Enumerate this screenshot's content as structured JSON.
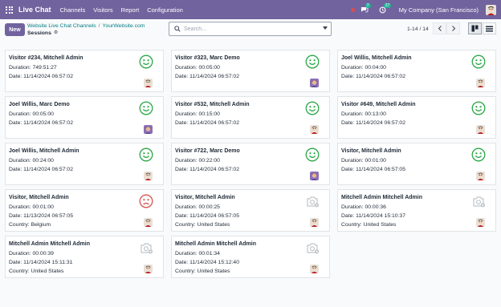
{
  "navbar": {
    "brand": "Live Chat",
    "menu": [
      "Channels",
      "Visitors",
      "Report",
      "Configuration"
    ],
    "chat_badge": "7",
    "activity_badge": "27",
    "company": "My Company (San Francisco)"
  },
  "control": {
    "new_label": "New",
    "breadcrumb_parent": "Website Live Chat Channels",
    "breadcrumb_parent2": "YourWebsite.com",
    "breadcrumb_current": "Sessions",
    "search_placeholder": "Search...",
    "pager": "1-14 / 14"
  },
  "colors": {
    "brand": "#71639e",
    "happy": "#28a745",
    "sad": "#d9534f",
    "none": "#c0c4c9"
  },
  "cards": [
    {
      "title": "Visitor #234, Mitchell Admin",
      "l1": "Duration: 749:51:27",
      "l2": "Date: 11/14/2024 06:57:02",
      "l3": "",
      "rating": "happy",
      "avatar": "admin"
    },
    {
      "title": "Visitor #323, Marc Demo",
      "l1": "Duration: 00:05:00",
      "l2": "Date: 11/14/2024 06:57:02",
      "l3": "",
      "rating": "happy",
      "avatar": "marc"
    },
    {
      "title": "Joel Willis, Mitchell Admin",
      "l1": "Duration: 00:04:00",
      "l2": "Date: 11/14/2024 06:57:02",
      "l3": "",
      "rating": "happy",
      "avatar": "admin"
    },
    {
      "title": "Joel Willis, Marc Demo",
      "l1": "Duration: 00:05:00",
      "l2": "Date: 11/14/2024 06:57:02",
      "l3": "",
      "rating": "happy",
      "avatar": "marc"
    },
    {
      "title": "Visitor #532, Mitchell Admin",
      "l1": "Duration: 00:15:00",
      "l2": "Date: 11/14/2024 06:57:02",
      "l3": "",
      "rating": "happy",
      "avatar": "admin"
    },
    {
      "title": "Visitor #649, Mitchell Admin",
      "l1": "Duration: 00:13:00",
      "l2": "Date: 11/14/2024 06:57:02",
      "l3": "",
      "rating": "happy",
      "avatar": "admin"
    },
    {
      "title": "Joel Willis, Mitchell Admin",
      "l1": "Duration: 00:24:00",
      "l2": "Date: 11/14/2024 06:57:02",
      "l3": "",
      "rating": "happy",
      "avatar": "admin"
    },
    {
      "title": "Visitor #722, Marc Demo",
      "l1": "Duration: 00:22:00",
      "l2": "Date: 11/14/2024 06:57:02",
      "l3": "",
      "rating": "happy",
      "avatar": "marc"
    },
    {
      "title": "Visitor, Mitchell Admin",
      "l1": "Duration: 00:01:00",
      "l2": "Date: 11/14/2024 06:57:05",
      "l3": "",
      "rating": "happy",
      "avatar": "admin"
    },
    {
      "title": "Visitor, Mitchell Admin",
      "l1": "Duration: 00:01:00",
      "l2": "Date: 11/13/2024 06:57:05",
      "l3": "Country: Belgium",
      "rating": "sad",
      "avatar": "admin"
    },
    {
      "title": "Visitor, Mitchell Admin",
      "l1": "Duration: 00:00:25",
      "l2": "Date: 11/14/2024 06:57:05",
      "l3": "Country: United States",
      "rating": "none",
      "avatar": "admin"
    },
    {
      "title": "Mitchell Admin Mitchell Admin",
      "l1": "Duration: 00:00:36",
      "l2": "Date: 11/14/2024 15:10:37",
      "l3": "Country: United States",
      "rating": "none",
      "avatar": "admin"
    },
    {
      "title": "Mitchell Admin Mitchell Admin",
      "l1": "Duration: 00:00:39",
      "l2": "Date: 11/14/2024 15:11:31",
      "l3": "Country: United States",
      "rating": "none",
      "avatar": "admin"
    },
    {
      "title": "Mitchell Admin Mitchell Admin",
      "l1": "Duration: 00:01:34",
      "l2": "Date: 11/14/2024 15:12:40",
      "l3": "Country: United States",
      "rating": "none",
      "avatar": "admin"
    }
  ]
}
